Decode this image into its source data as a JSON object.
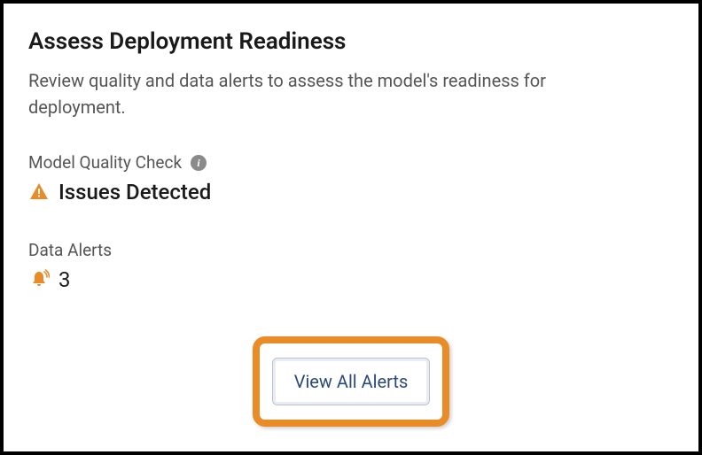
{
  "panel": {
    "title": "Assess Deployment Readiness",
    "description": "Review quality and data alerts to assess the model's readiness for deployment."
  },
  "quality_check": {
    "label": "Model Quality Check",
    "status": "Issues Detected"
  },
  "data_alerts": {
    "label": "Data Alerts",
    "count": "3"
  },
  "actions": {
    "view_all_label": "View All Alerts"
  },
  "colors": {
    "warning": "#e98b26",
    "highlight_border": "#e98b26",
    "button_text": "#2b4a7a"
  }
}
